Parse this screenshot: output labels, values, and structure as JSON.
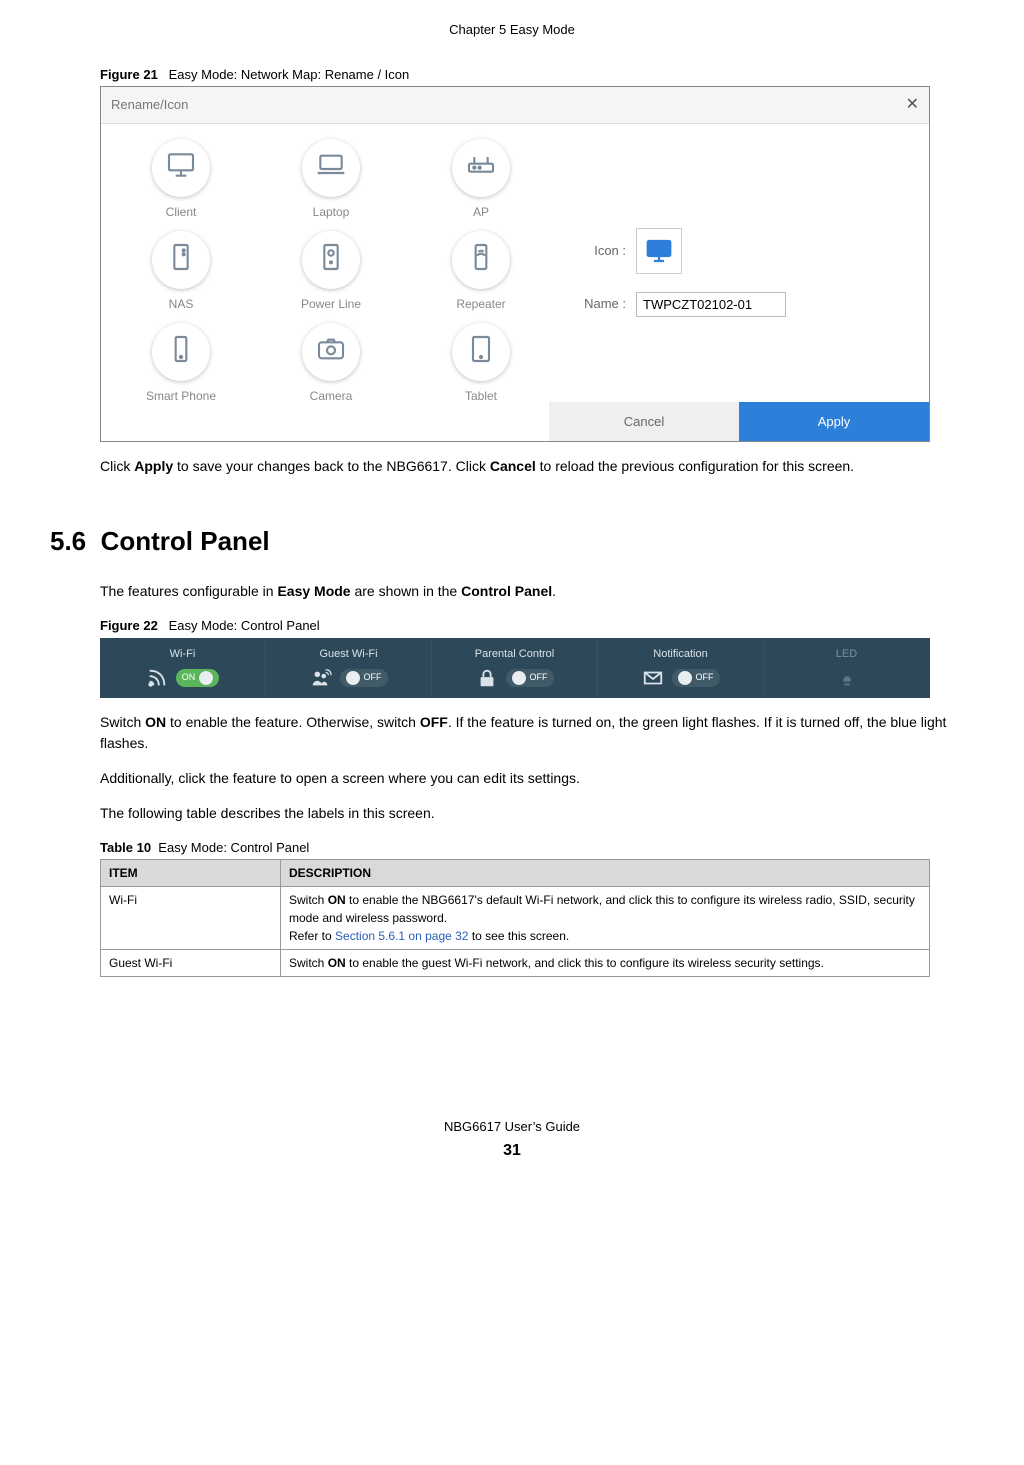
{
  "chapter": "Chapter 5 Easy Mode",
  "figure21": {
    "label_prefix": "Figure 21",
    "caption": "Easy Mode: Network Map: Rename / Icon",
    "dialog_title": "Rename/Icon",
    "close_glyph": "✕",
    "icons": [
      {
        "id": "client",
        "label": "Client"
      },
      {
        "id": "laptop",
        "label": "Laptop"
      },
      {
        "id": "ap",
        "label": "AP"
      },
      {
        "id": "nas",
        "label": "NAS"
      },
      {
        "id": "powerline",
        "label": "Power Line"
      },
      {
        "id": "repeater",
        "label": "Repeater"
      },
      {
        "id": "smartphone",
        "label": "Smart Phone"
      },
      {
        "id": "camera",
        "label": "Camera"
      },
      {
        "id": "tablet",
        "label": "Tablet"
      }
    ],
    "field_icon_label": "Icon :",
    "field_name_label": "Name :",
    "name_value": "TWPCZT02102-01",
    "cancel": "Cancel",
    "apply": "Apply"
  },
  "para_after_fig21_a": "Click ",
  "para_after_fig21_b": "Apply",
  "para_after_fig21_c": " to save your changes back to the NBG6617. Click ",
  "para_after_fig21_d": "Cancel",
  "para_after_fig21_e": " to reload the previous configuration for this screen.",
  "section": {
    "num": "5.6",
    "title": "Control Panel"
  },
  "section_intro_a": "The features configurable in ",
  "section_intro_b": "Easy Mode",
  "section_intro_c": " are shown in the ",
  "section_intro_d": "Control Panel",
  "section_intro_e": ".",
  "figure22": {
    "label_prefix": "Figure 22",
    "caption": "Easy Mode: Control Panel",
    "items": [
      {
        "label": "Wi-Fi",
        "state": "ON",
        "on": true
      },
      {
        "label": "Guest Wi-Fi",
        "state": "OFF",
        "on": false
      },
      {
        "label": "Parental Control",
        "state": "OFF",
        "on": false
      },
      {
        "label": "Notification",
        "state": "OFF",
        "on": false
      },
      {
        "label": "LED",
        "state": "",
        "on": false,
        "dim": true
      }
    ]
  },
  "para_switch_a": "Switch ",
  "para_switch_b": "ON",
  "para_switch_c": " to enable the feature. Otherwise, switch ",
  "para_switch_d": "OFF",
  "para_switch_e": ". If the feature is turned on, the green light flashes. If it is turned off, the blue light flashes.",
  "para_addl": "Additionally, click the feature to open a screen where you can edit its settings.",
  "para_table_intro": "The following table describes the labels in this screen.",
  "table10": {
    "label_prefix": "Table 10",
    "caption": "Easy Mode: Control Panel",
    "head_item": "ITEM",
    "head_desc": "DESCRIPTION",
    "rows": [
      {
        "item": "Wi-Fi",
        "desc_a": "Switch ",
        "desc_b": "ON",
        "desc_c": " to enable the NBG6617's default Wi-Fi network, and click this to configure its wireless radio, SSID, security mode and wireless password.",
        "link_prefix": "Refer to ",
        "link_text": "Section 5.6.1 on page 32",
        "link_suffix": " to see this screen."
      },
      {
        "item": "Guest Wi-Fi",
        "desc_a": "Switch ",
        "desc_b": "ON",
        "desc_c": " to enable the guest Wi-Fi network, and click this to configure its wireless security settings.",
        "link_prefix": "",
        "link_text": "",
        "link_suffix": ""
      }
    ]
  },
  "footer": {
    "guide": "NBG6617 User’s Guide",
    "page": "31"
  }
}
